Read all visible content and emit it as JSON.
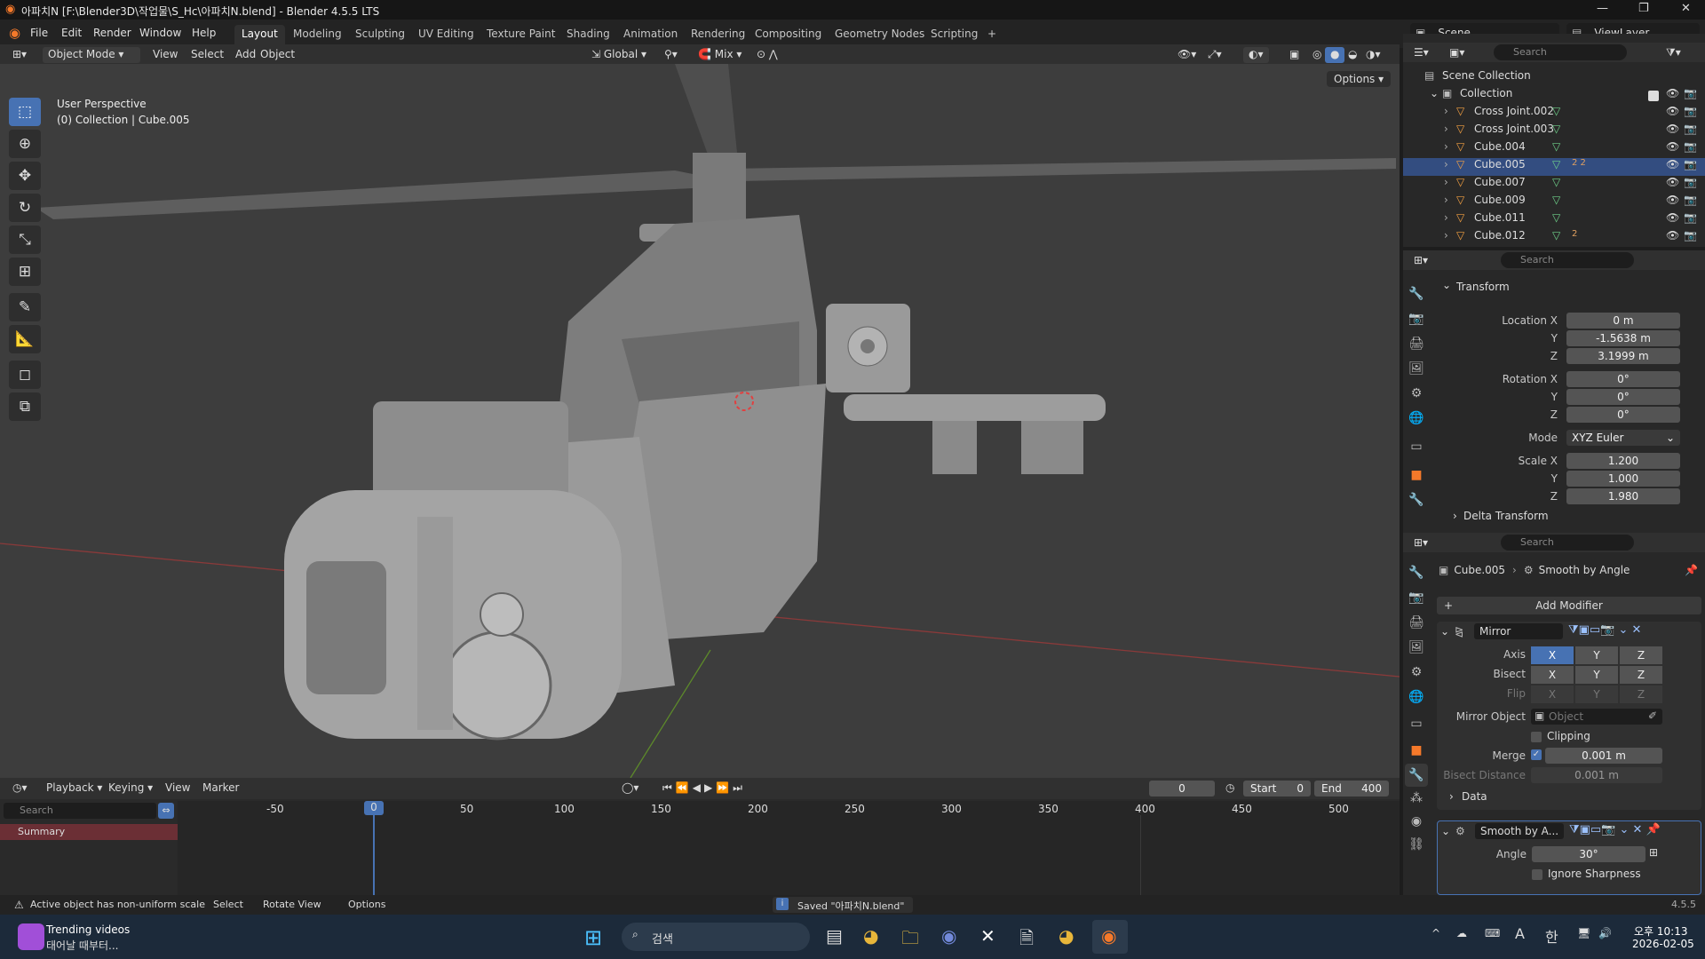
{
  "window": {
    "title": "아파치N [F:\\Blender3D\\작업물\\S_Hc\\아파치N.blend] - Blender 4.5.5 LTS",
    "minimize": "—",
    "maximize": "❐",
    "close": "✕"
  },
  "menu": [
    "File",
    "Edit",
    "Render",
    "Window",
    "Help"
  ],
  "workspaces": [
    "Layout",
    "Modeling",
    "Sculpting",
    "UV Editing",
    "Texture Paint",
    "Shading",
    "Animation",
    "Rendering",
    "Compositing",
    "Geometry Nodes",
    "Scripting"
  ],
  "workspace_add": "+",
  "scene": {
    "label": "Scene",
    "viewlayer": "ViewLayer"
  },
  "viewport_header": {
    "mode": "Object Mode",
    "menus": [
      "View",
      "Select",
      "Add",
      "Object"
    ],
    "transform_orientation": "Global",
    "snap": "Mix",
    "options": "Options"
  },
  "viewport": {
    "perspective_label": "User Perspective",
    "collection_label": "(0) Collection | Cube.005"
  },
  "outliner": {
    "search_placeholder": "Search",
    "scene_collection": "Scene Collection",
    "collection": "Collection",
    "items": [
      {
        "name": "Cross Joint.002",
        "badge": ""
      },
      {
        "name": "Cross Joint.003",
        "badge": ""
      },
      {
        "name": "Cube.004",
        "badge": ""
      },
      {
        "name": "Cube.005",
        "badge": "2 2"
      },
      {
        "name": "Cube.007",
        "badge": ""
      },
      {
        "name": "Cube.009",
        "badge": ""
      },
      {
        "name": "Cube.011",
        "badge": ""
      },
      {
        "name": "Cube.012",
        "badge": "2"
      }
    ]
  },
  "properties": {
    "search_placeholder": "Search",
    "transform_title": "Transform",
    "location": {
      "label": "Location X",
      "x": "0 m",
      "y": "-1.5638 m",
      "z": "3.1999 m"
    },
    "rotation": {
      "label": "Rotation X",
      "x": "0°",
      "y": "0°",
      "z": "0°"
    },
    "mode": {
      "label": "Mode",
      "value": "XYZ Euler"
    },
    "scale": {
      "label": "Scale X",
      "x": "1.200",
      "y": "1.000",
      "z": "1.980"
    },
    "axis_y": "Y",
    "axis_z": "Z",
    "delta": "Delta Transform"
  },
  "modifiers": {
    "search_placeholder": "Search",
    "object": "Cube.005",
    "breadcrumb_modifier": "Smooth by Angle",
    "add_modifier": "Add Modifier",
    "mirror": {
      "name": "Mirror",
      "axis_label": "Axis",
      "bisect_label": "Bisect",
      "flip_label": "Flip",
      "x": "X",
      "y": "Y",
      "z": "Z",
      "mirror_object_label": "Mirror Object",
      "mirror_object_placeholder": "Object",
      "clipping": "Clipping",
      "merge_label": "Merge",
      "merge_value": "0.001 m",
      "bisect_distance_label": "Bisect Distance",
      "bisect_distance_value": "0.001 m",
      "data": "Data"
    },
    "smooth": {
      "name": "Smooth by A...",
      "angle_label": "Angle",
      "angle_value": "30°",
      "ignore_sharpness": "Ignore Sharpness"
    }
  },
  "timeline": {
    "menus": [
      "Playback",
      "Keying",
      "View",
      "Marker"
    ],
    "current_frame": "0",
    "start_label": "Start",
    "start": "0",
    "end_label": "End",
    "end": "400",
    "search_placeholder": "Search",
    "summary": "Summary",
    "ruler": [
      "-50",
      "0",
      "50",
      "100",
      "150",
      "200",
      "250",
      "300",
      "350",
      "400",
      "450",
      "500"
    ]
  },
  "statusbar": {
    "warning": "Active object has non-uniform scale",
    "select": "Select",
    "rotate": "Rotate View",
    "options": "Options",
    "saved": "Saved \"아파치N.blend\"",
    "version": "4.5.5"
  },
  "taskbar": {
    "widget_title": "Trending videos",
    "widget_sub": "태어날 때부터...",
    "search": "검색",
    "time": "오후 10:13",
    "date": "2026-02-05",
    "ime_a": "A",
    "ime_han": "한"
  },
  "colors": {
    "accent": "#4772b3",
    "viewport_bg": "#3d3d3d",
    "panel_bg": "#282828"
  }
}
